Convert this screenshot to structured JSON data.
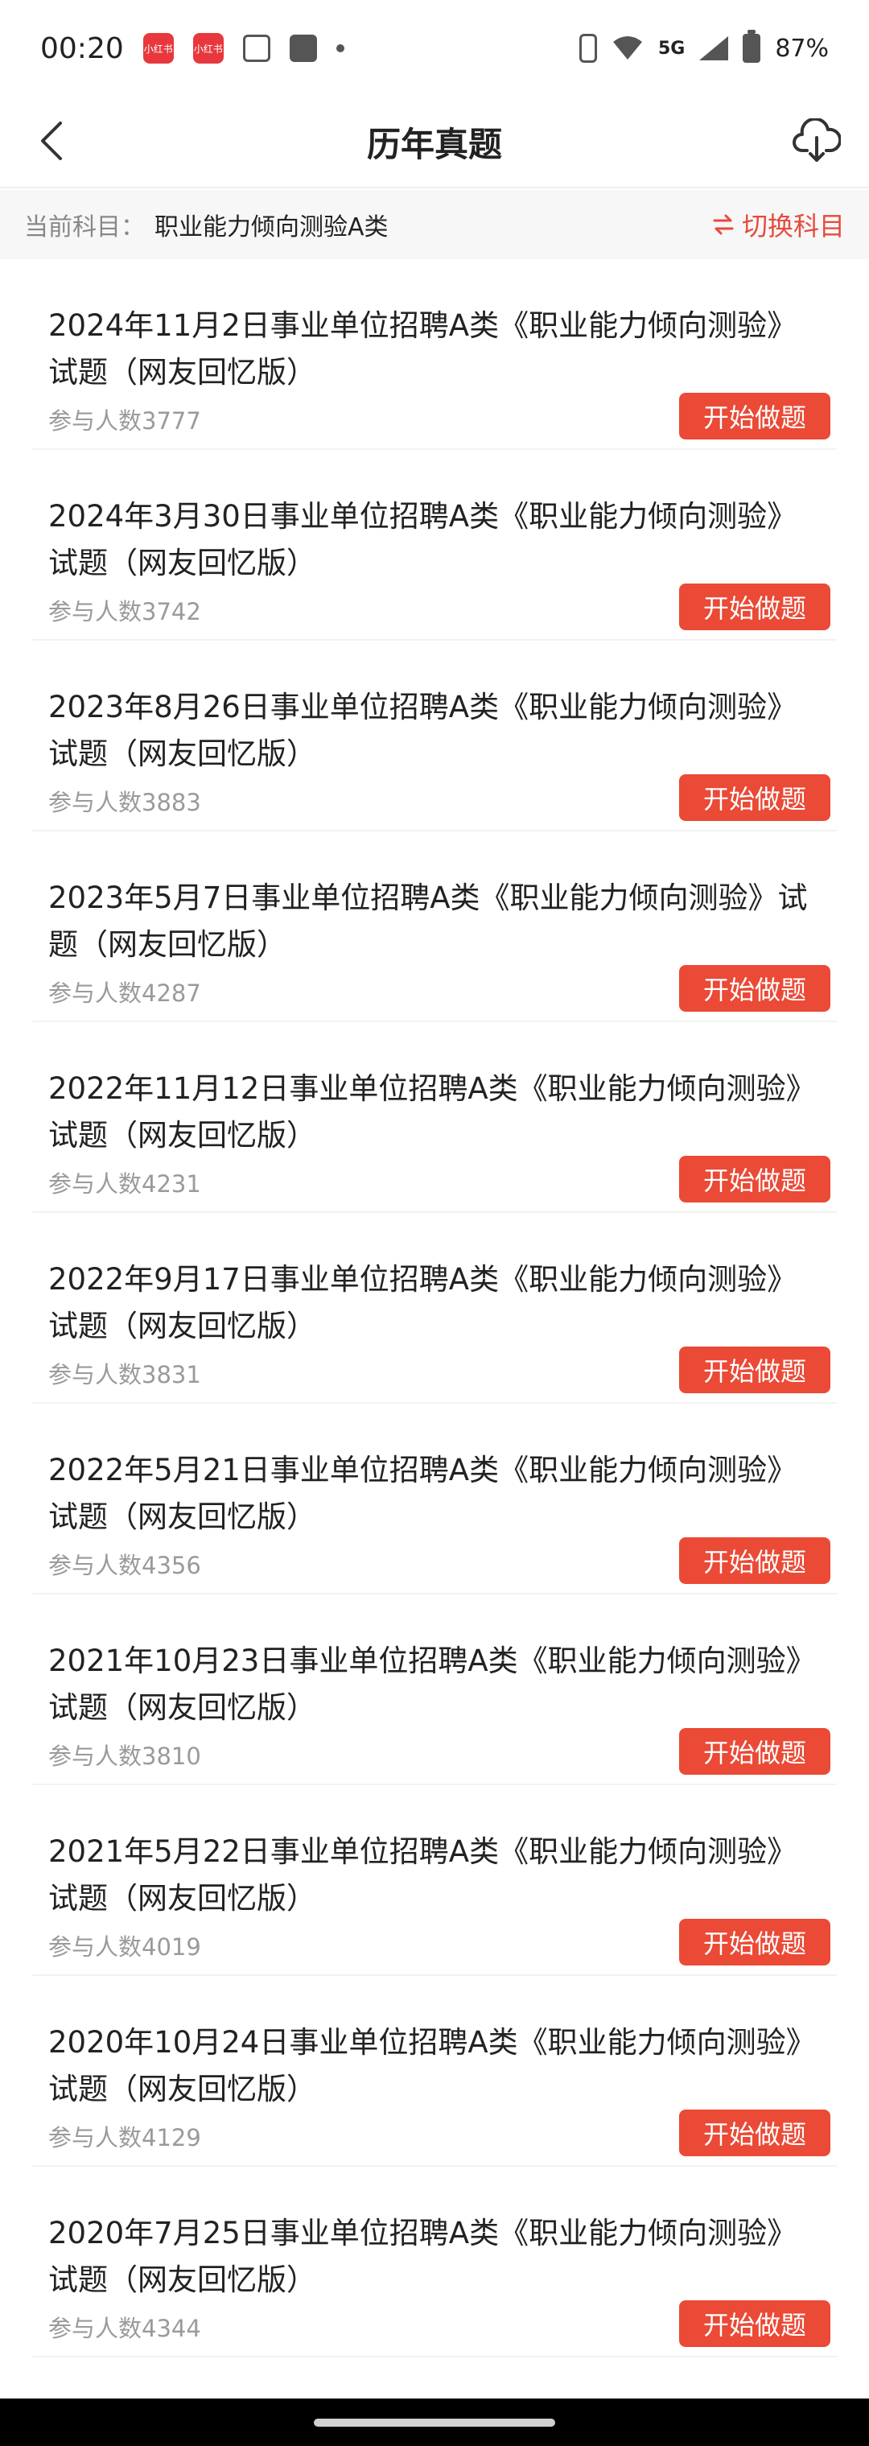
{
  "status_bar": {
    "time": "00:20",
    "app_badges": [
      "小红书",
      "小红书"
    ],
    "network": "5G",
    "battery": "87%"
  },
  "header": {
    "title": "历年真题"
  },
  "subject": {
    "label": "当前科目：",
    "value": "职业能力倾向测验A类",
    "switch_label": "切换科目"
  },
  "list": {
    "items": [
      {
        "title": "2024年11月2日事业单位招聘A类《职业能力倾向测验》试题（网友回忆版）",
        "participants": "参与人数3777",
        "button": "开始做题"
      },
      {
        "title": "2024年3月30日事业单位招聘A类《职业能力倾向测验》试题（网友回忆版）",
        "participants": "参与人数3742",
        "button": "开始做题"
      },
      {
        "title": "2023年8月26日事业单位招聘A类《职业能力倾向测验》试题（网友回忆版）",
        "participants": "参与人数3883",
        "button": "开始做题"
      },
      {
        "title": "2023年5月7日事业单位招聘A类《职业能力倾向测验》试题（网友回忆版）",
        "participants": "参与人数4287",
        "button": "开始做题"
      },
      {
        "title": "2022年11月12日事业单位招聘A类《职业能力倾向测验》试题（网友回忆版）",
        "participants": "参与人数4231",
        "button": "开始做题"
      },
      {
        "title": "2022年9月17日事业单位招聘A类《职业能力倾向测验》试题（网友回忆版）",
        "participants": "参与人数3831",
        "button": "开始做题"
      },
      {
        "title": "2022年5月21日事业单位招聘A类《职业能力倾向测验》试题（网友回忆版）",
        "participants": "参与人数4356",
        "button": "开始做题"
      },
      {
        "title": "2021年10月23日事业单位招聘A类《职业能力倾向测验》试题（网友回忆版）",
        "participants": "参与人数3810",
        "button": "开始做题"
      },
      {
        "title": "2021年5月22日事业单位招聘A类《职业能力倾向测验》试题（网友回忆版）",
        "participants": "参与人数4019",
        "button": "开始做题"
      },
      {
        "title": "2020年10月24日事业单位招聘A类《职业能力倾向测验》试题（网友回忆版）",
        "participants": "参与人数4129",
        "button": "开始做题"
      },
      {
        "title": "2020年7月25日事业单位招聘A类《职业能力倾向测验》试题（网友回忆版）",
        "participants": "参与人数4344",
        "button": "开始做题"
      }
    ]
  },
  "icons": {
    "back": "chevron-left-icon",
    "download": "cloud-download-icon",
    "switch": "swap-arrows-icon"
  },
  "colors": {
    "accent": "#ea4a36"
  }
}
